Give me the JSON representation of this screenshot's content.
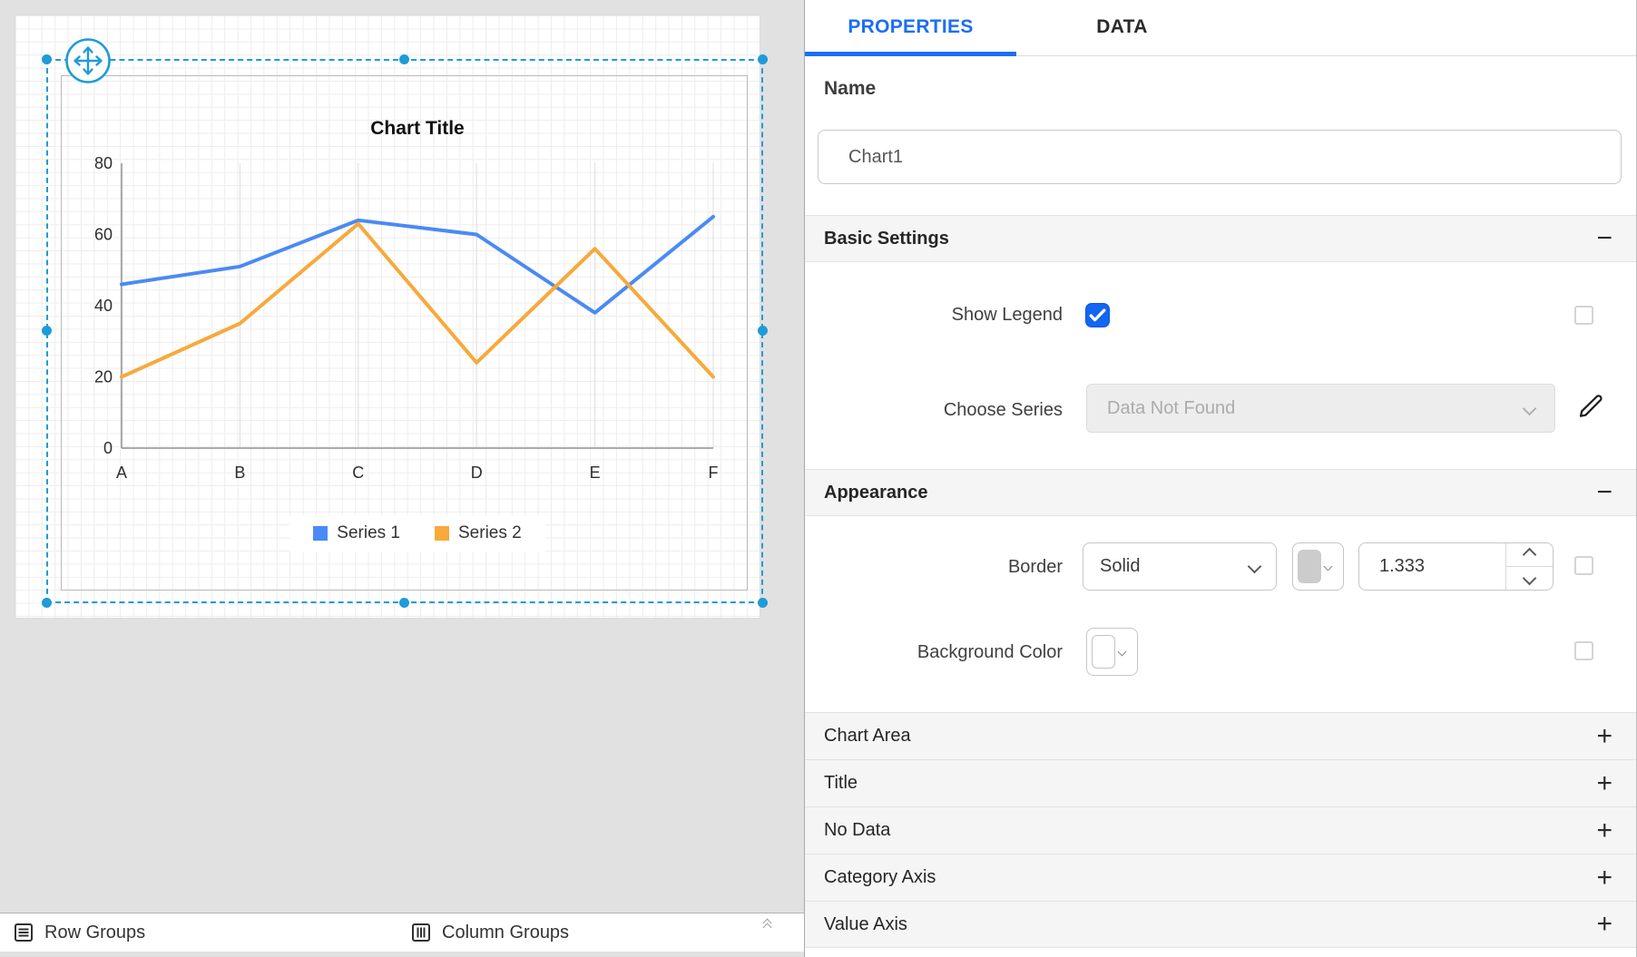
{
  "canvas": {
    "selection_color": "#1f9bd8",
    "footer": {
      "row_groups_label": "Row Groups",
      "column_groups_label": "Column Groups"
    }
  },
  "chart_data": {
    "type": "line",
    "title": "Chart Title",
    "categories": [
      "A",
      "B",
      "C",
      "D",
      "E",
      "F"
    ],
    "series": [
      {
        "name": "Series 1",
        "color": "#4a8af4",
        "values": [
          46,
          51,
          64,
          60,
          38,
          65
        ]
      },
      {
        "name": "Series 2",
        "color": "#f7a93b",
        "values": [
          20,
          35,
          63,
          24,
          56,
          20
        ]
      }
    ],
    "xlabel": "",
    "ylabel": "",
    "ylim": [
      0,
      80
    ],
    "yticks": [
      0,
      20,
      40,
      60,
      80
    ],
    "grid": "vertical-only",
    "legend_position": "bottom"
  },
  "panel": {
    "tabs": {
      "properties": "PROPERTIES",
      "data": "DATA",
      "active": "PROPERTIES",
      "accent": "#1b6ef3"
    },
    "name": {
      "label": "Name",
      "value": "Chart1"
    },
    "icons": {
      "collapse": "−",
      "expand": "+"
    },
    "basic_settings": {
      "title": "Basic Settings",
      "show_legend": {
        "label": "Show Legend",
        "checked": true
      },
      "choose_series": {
        "label": "Choose Series",
        "value": "Data Not Found",
        "disabled": true
      }
    },
    "appearance": {
      "title": "Appearance",
      "border": {
        "label": "Border",
        "style": "Solid",
        "width": "1.333",
        "color_swatch": "#cccccc"
      },
      "background_color": {
        "label": "Background Color",
        "color_swatch": "#ffffff"
      }
    },
    "collapsed_sections": [
      {
        "label": "Chart Area"
      },
      {
        "label": "Title"
      },
      {
        "label": "No Data"
      },
      {
        "label": "Category Axis"
      },
      {
        "label": "Value Axis"
      }
    ]
  }
}
